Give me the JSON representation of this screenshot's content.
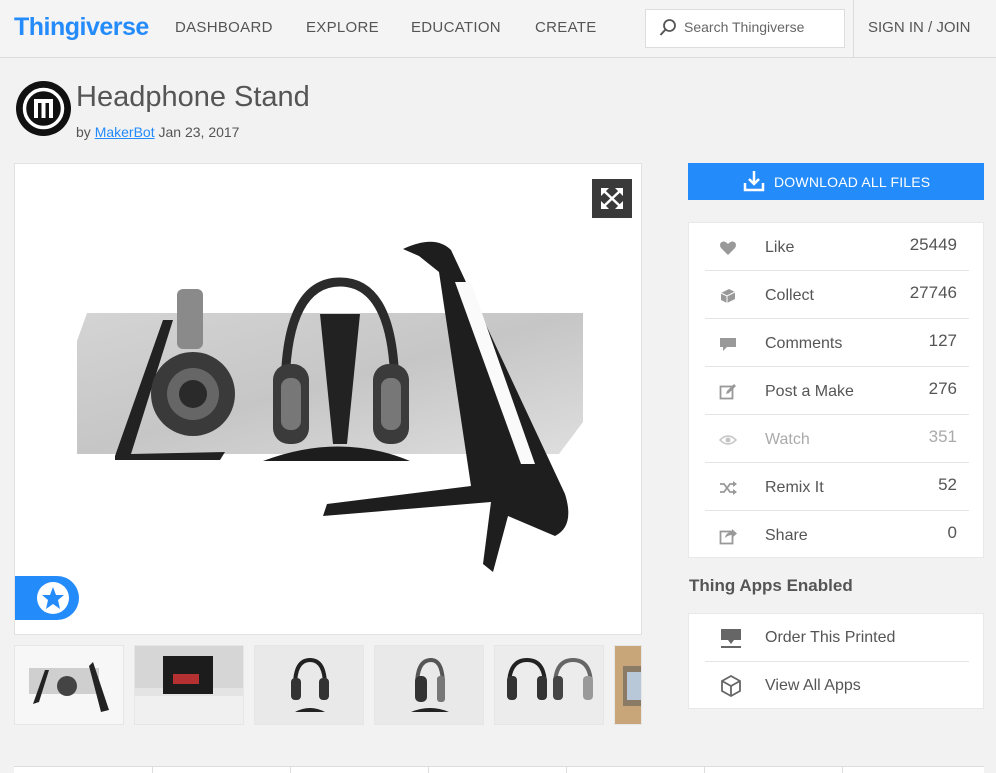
{
  "header": {
    "logo": "Thingiverse",
    "nav": [
      "DASHBOARD",
      "EXPLORE",
      "EDUCATION",
      "CREATE"
    ],
    "search_placeholder": "Search Thingiverse",
    "signin": "SIGN IN / JOIN"
  },
  "thing": {
    "title": "Headphone Stand",
    "by": "by",
    "author": "MakerBot",
    "date": "Jan 23, 2017"
  },
  "download_label": "DOWNLOAD ALL FILES",
  "stats": [
    {
      "label": "Like",
      "value": "25449",
      "icon": "heart-icon"
    },
    {
      "label": "Collect",
      "value": "27746",
      "icon": "collect-icon"
    },
    {
      "label": "Comments",
      "value": "127",
      "icon": "comment-icon"
    },
    {
      "label": "Post a Make",
      "value": "276",
      "icon": "edit-icon"
    },
    {
      "label": "Watch",
      "value": "351",
      "icon": "eye-icon"
    },
    {
      "label": "Remix It",
      "value": "52",
      "icon": "shuffle-icon"
    },
    {
      "label": "Share",
      "value": "0",
      "icon": "share-icon"
    }
  ],
  "apps_heading": "Thing Apps Enabled",
  "apps": [
    {
      "label": "Order This Printed",
      "icon": "printer-icon"
    },
    {
      "label": "View All Apps",
      "icon": "cube-icon"
    }
  ],
  "colors": {
    "accent": "#248bfb",
    "background": "#f2f2f2"
  }
}
